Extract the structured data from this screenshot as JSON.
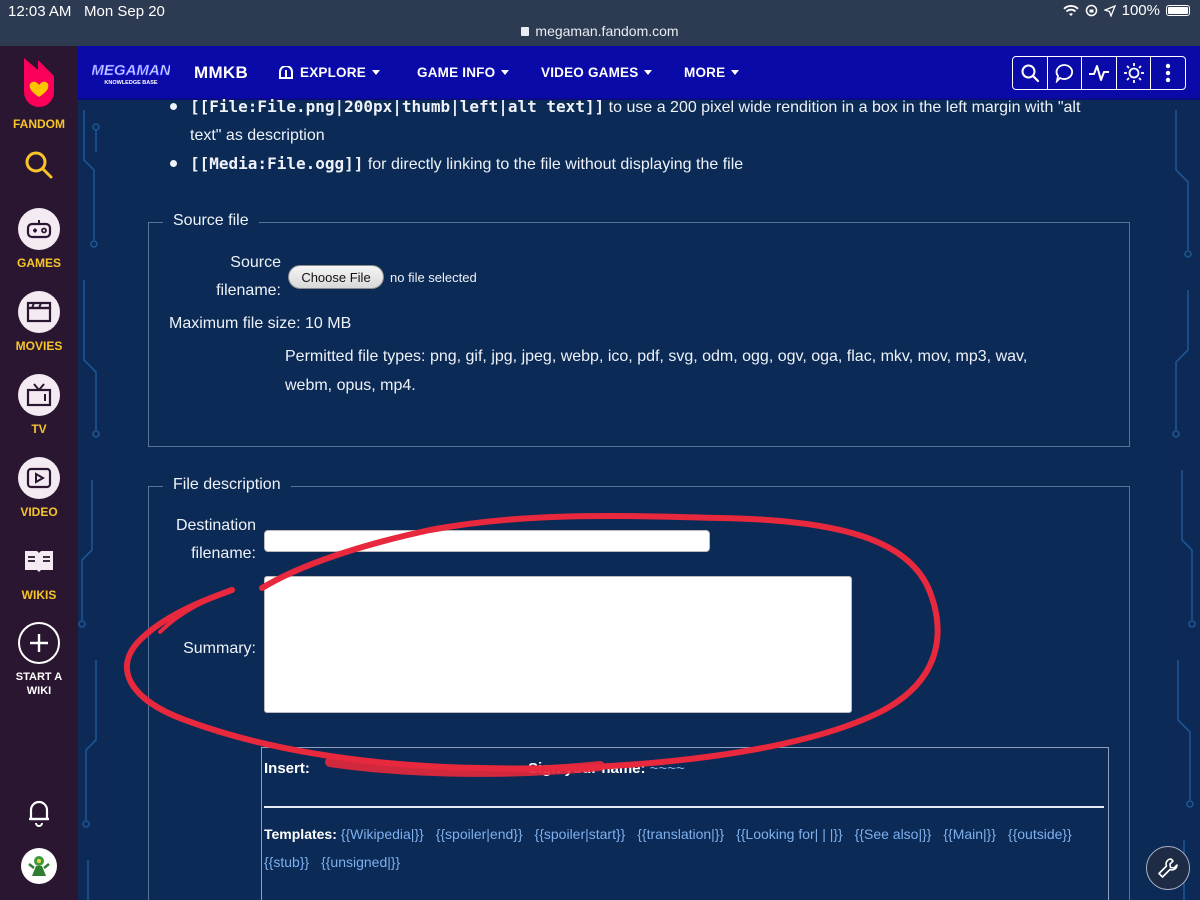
{
  "status_bar": {
    "time": "12:03 AM",
    "date": "Mon Sep 20",
    "url": "megaman.fandom.com",
    "battery": "100%"
  },
  "fandom_rail": {
    "brand": "FANDOM",
    "items": [
      {
        "label": "GAMES",
        "icon": "gamepad-icon"
      },
      {
        "label": "MOVIES",
        "icon": "clapperboard-icon"
      },
      {
        "label": "TV",
        "icon": "tv-icon"
      },
      {
        "label": "VIDEO",
        "icon": "play-icon"
      },
      {
        "label": "WIKIS",
        "icon": "book-icon"
      },
      {
        "label": "START A WIKI",
        "icon": "plus-icon"
      }
    ]
  },
  "wiki_header": {
    "logo_text": "MEGAMAN",
    "logo_subtext": "KNOWLEDGE BASE",
    "wiki_name": "MMKB",
    "nav": [
      "EXPLORE",
      "GAME INFO",
      "VIDEO GAMES",
      "MORE"
    ]
  },
  "content": {
    "bullet1_code": "[[File:File.png|200px|thumb|left|alt text]]",
    "bullet1_text": " to use a 200 pixel wide rendition in a box in the left margin with \"alt",
    "bullet1_cont": "text\" as description",
    "bullet2_code": "[[Media:File.ogg]]",
    "bullet2_text": " for directly linking to the file without displaying the file",
    "source_file": {
      "legend": "Source file",
      "label_line1": "Source",
      "label_line2": "filename:",
      "button": "Choose File",
      "no_file": "no file selected",
      "max_size": "Maximum file size: 10 MB",
      "permitted_line1": "Permitted file types: png, gif, jpg, jpeg, webp, ico, pdf, svg, odm, ogg, ogv, oga, flac, mkv, mov, mp3, wav,",
      "permitted_line2": "webm, opus, mp4."
    },
    "file_description": {
      "legend": "File description",
      "dest_label_line1": "Destination",
      "dest_label_line2": "filename:",
      "summary_label": "Summary:",
      "insert_label": "Insert:",
      "sign_label": "Sign your name:",
      "sign_value": "~~~~",
      "templates_label": "Templates:",
      "templates": [
        "{{Wikipedia|}}",
        "{{spoiler|end}}",
        "{{spoiler|start}}",
        "{{translation|}}",
        "{{Looking for| | |}}",
        "{{See also|}}",
        "{{Main|}}",
        "{{outside}}",
        "{{stub}}",
        "{{unsigned|}}"
      ]
    }
  },
  "colors": {
    "header_blue": "#0a0aa8",
    "content_bg": "#0b2a55",
    "rail_bg": "#2a1631",
    "rail_label": "#f7c52a",
    "link": "#7fb0ee",
    "annotation_red": "#e8283c"
  }
}
